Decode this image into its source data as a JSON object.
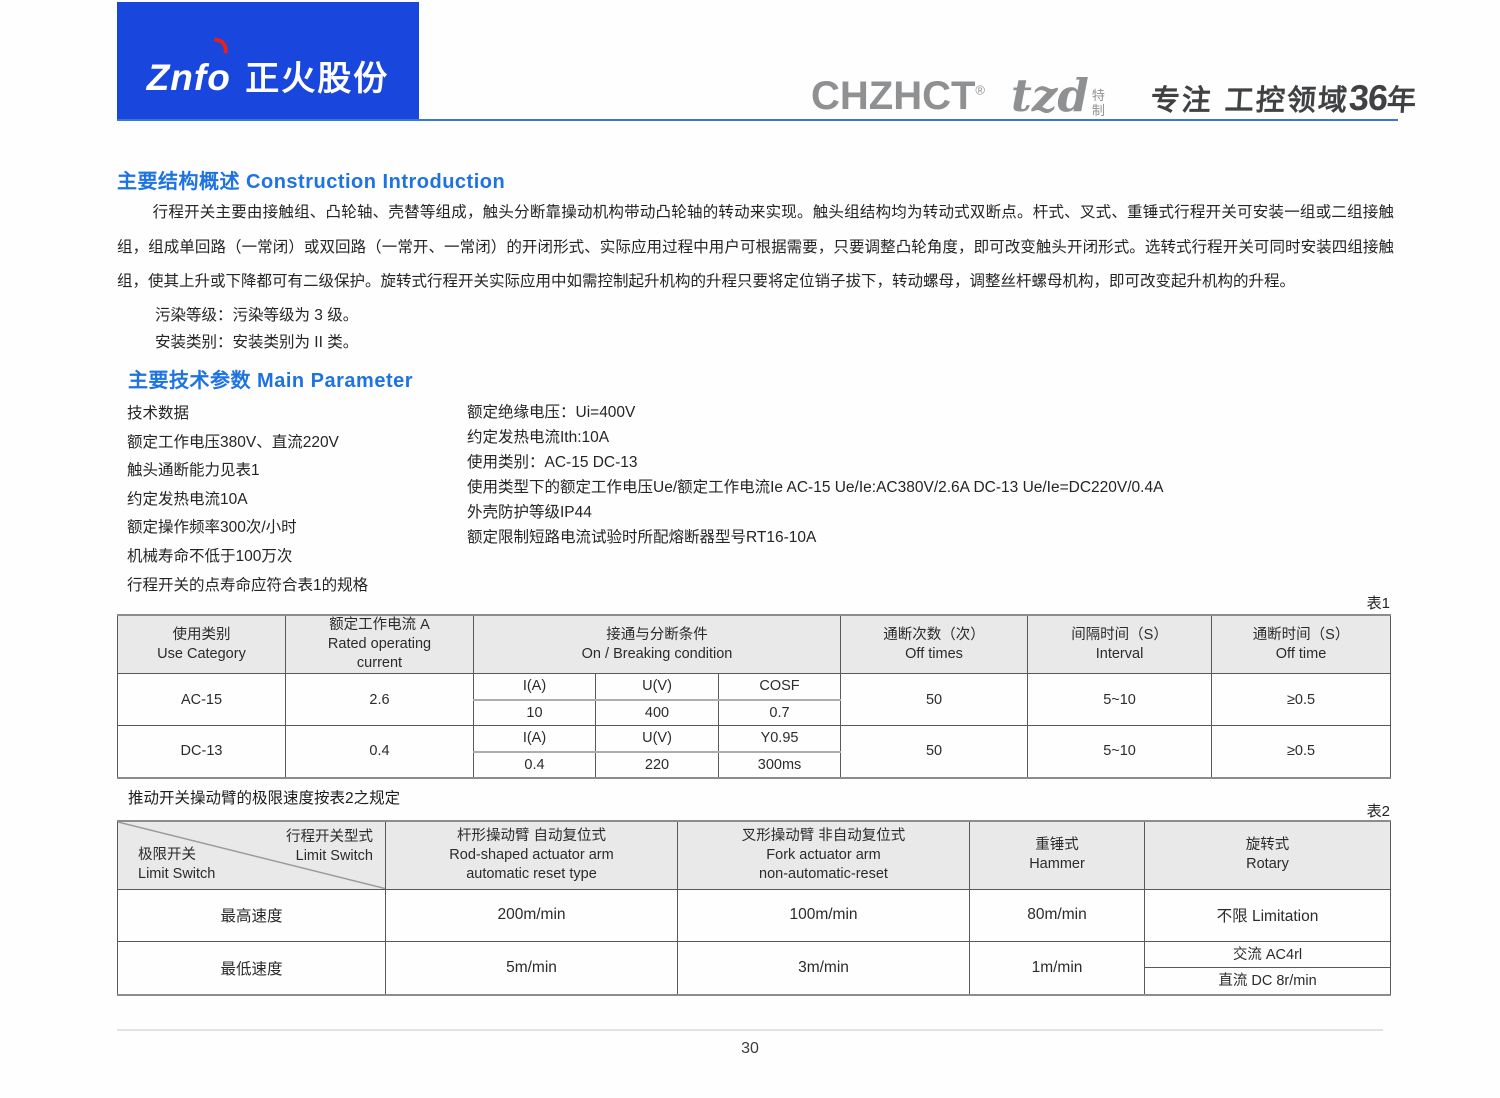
{
  "header": {
    "logo_en": "Znfo",
    "logo_cn": "正火股份",
    "brand": "CHZHCT",
    "brand_reg": "®",
    "brand_tzd": "tzd",
    "tzd_sub1": "特",
    "tzd_sub2": "制",
    "slogan_prefix": "专注 工控领域",
    "slogan_num": "36",
    "slogan_suffix": "年"
  },
  "section1": {
    "title": "主要结构概述 Construction Introduction",
    "paragraph": "行程开关主要由接触组、凸轮轴、壳替等组成，触头分断靠操动机构带动凸轮轴的转动来实现。触头组结构均为转动式双断点。杆式、叉式、重锤式行程开关可安装一组或二组接触组，组成单回路（一常闭）或双回路（一常开、一常闭）的开闭形式、实际应用过程中用户可根据需要，只要调整凸轮角度，即可改变触头开闭形式。选转式行程开关可同时安装四组接触组，使其上升或下降都可有二级保护。旋转式行程开关实际应用中如需控制起升机构的升程只要将定位销子拔下，转动螺母，调整丝杆螺母机构，即可改变起升机构的升程。",
    "line_pollution": "污染等级：污染等级为 3 级。",
    "line_install": "安装类别：安装类别为 II 类。"
  },
  "section2": {
    "title": "主要技术参数 Main Parameter",
    "left_items": [
      "技术数据",
      "额定工作电压380V、直流220V",
      "触头通断能力见表1",
      "约定发热电流10A",
      "额定操作频率300次/小时",
      "机械寿命不低于100万次",
      "行程开关的点寿命应符合表1的规格"
    ],
    "right_items": [
      "额定绝缘电压：Ui=400V",
      "约定发热电流Ith:10A",
      "使用类别：AC-15  DC-13",
      "使用类型下的额定工作电压Ue/额定工作电流Ie AC-15  Ue/Ie:AC380V/2.6A DC-13 Ue/Ie=DC220V/0.4A",
      "外壳防护等级IP44",
      "额定限制短路电流试验时所配熔断器型号RT16-10A"
    ]
  },
  "table1": {
    "label": "表1",
    "headers": {
      "c1_zh": "使用类别",
      "c1_en": "Use Category",
      "c2_zh": "额定工作电流 A",
      "c2_en": "Rated operating current",
      "c3_zh": "接通与分断条件",
      "c3_en": "On / Breaking condition",
      "c4_zh": "通断次数（次）",
      "c4_en": "Off times",
      "c5_zh": "间隔时间（S）",
      "c5_en": "Interval",
      "c6_zh": "通断时间（S）",
      "c6_en": "Off time"
    },
    "rows": [
      {
        "category": "AC-15",
        "current": "2.6",
        "sub_top": [
          "I(A)",
          "U(V)",
          "COSF"
        ],
        "sub_bottom": [
          "10",
          "400",
          "0.7"
        ],
        "off_times": "50",
        "interval": "5~10",
        "off_time": "≥0.5"
      },
      {
        "category": "DC-13",
        "current": "0.4",
        "sub_top": [
          "I(A)",
          "U(V)",
          "Y0.95"
        ],
        "sub_bottom": [
          "0.4",
          "220",
          "300ms"
        ],
        "off_times": "50",
        "interval": "5~10",
        "off_time": "≥0.5"
      }
    ]
  },
  "note": "推动开关操动臂的极限速度按表2之规定",
  "table2": {
    "label": "表2",
    "corner": {
      "top_zh": "行程开关型式",
      "top_en": "Limit Switch",
      "bottom_zh": "极限开关",
      "bottom_en": "Limit Switch"
    },
    "headers": [
      {
        "zh": "杆形操动臂 自动复位式",
        "en1": "Rod-shaped actuator arm",
        "en2": "automatic reset type"
      },
      {
        "zh": "叉形操动臂 非自动复位式",
        "en1": "Fork actuator arm",
        "en2": "non-automatic-reset"
      },
      {
        "zh": "重锤式",
        "en1": "Hammer",
        "en2": ""
      },
      {
        "zh": "旋转式",
        "en1": "Rotary",
        "en2": ""
      }
    ],
    "rows": [
      {
        "label": "最高速度",
        "v1": "200m/min",
        "v2": "100m/min",
        "v3": "80m/min",
        "rotary": "不限 Limitation"
      },
      {
        "label": "最低速度",
        "v1": "5m/min",
        "v2": "3m/min",
        "v3": "1m/min",
        "rotary_ac": "交流 AC4rl",
        "rotary_dc": "直流 DC 8r/min"
      }
    ]
  },
  "footer": {
    "page_number": "30"
  }
}
